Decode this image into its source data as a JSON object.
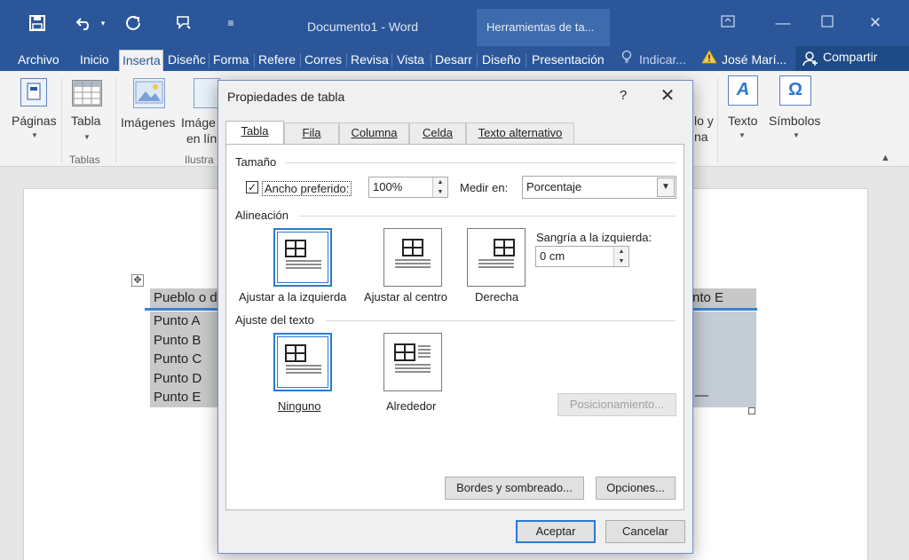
{
  "titlebar": {
    "doc_title": "Documento1 - Word",
    "context_title": "Herramientas de ta...",
    "qat_menu": "≡"
  },
  "tabs": {
    "archivo": "Archivo",
    "inicio": "Inicio",
    "inserta": "Inserta",
    "diseno": "Diseñc",
    "forma": "Forma",
    "refere": "Refere",
    "corres": "Corres",
    "revisa": "Revisa",
    "vista": "Vista",
    "desarr": "Desarr",
    "diseno2": "Diseño",
    "presentacion": "Presentación",
    "indicar": "Indicar...",
    "user": "José Marí...",
    "share": "Compartir"
  },
  "ribbon": {
    "paginas": "Páginas",
    "tabla": "Tabla",
    "tablas_group": "Tablas",
    "imagenes": "Imágenes",
    "imagenes_linea_1": "Imáge",
    "imagenes_linea_2": "en lín",
    "ilustra_group": "Ilustra",
    "vinculos_partial_1": "lo y",
    "vinculos_partial_2": "na",
    "texto": "Texto",
    "simbolos": "Símbolos"
  },
  "document": {
    "header_left": "Pueblo o d",
    "header_right": "nto E",
    "rows": [
      "Punto A",
      "Punto B",
      "Punto C",
      "Punto D",
      "Punto E"
    ],
    "dash": "—"
  },
  "dialog": {
    "title": "Propiedades de tabla",
    "help": "?",
    "tabs": [
      "Tabla",
      "Fila",
      "Columna",
      "Celda",
      "Texto alternativo"
    ],
    "size_section": "Tamaño",
    "preferred_width_label": "Ancho preferido:",
    "preferred_width_checked": true,
    "preferred_width_value": "100%",
    "measure_label": "Medir en:",
    "measure_value": "Porcentaje",
    "alignment_section": "Alineación",
    "align_left": "Ajustar a la izquierda",
    "align_center": "Ajustar al centro",
    "align_right": "Derecha",
    "indent_label": "Sangría a la izquierda:",
    "indent_value": "0 cm",
    "wrap_section": "Ajuste del texto",
    "wrap_none": "Ninguno",
    "wrap_around": "Alrededor",
    "positioning_button": "Posicionamiento...",
    "borders_button": "Bordes y sombreado...",
    "options_button": "Opciones...",
    "ok_button": "Aceptar",
    "cancel_button": "Cancelar"
  },
  "colors": {
    "brand": "#2b579a",
    "selection": "#2b7ad0"
  }
}
